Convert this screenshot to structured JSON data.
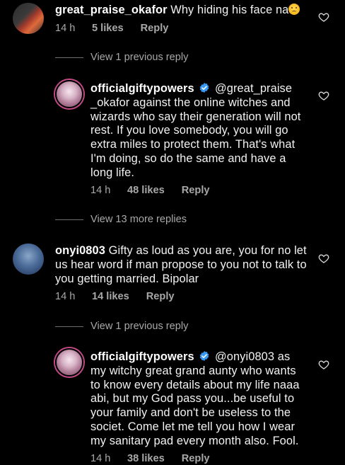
{
  "comments": [
    {
      "username": "great_praise_okafor",
      "text": "Why hiding his face na",
      "emoji": "worried-face",
      "time": "14 h",
      "likes": "5 likes",
      "reply_label": "Reply"
    },
    {
      "username": "officialgiftypowers",
      "verified": true,
      "mention": "@great_praise _okafor",
      "text": "against the online witches and wizards who say their generation will not rest. If you love somebody, you will go extra miles to protect them. That's what I'm doing, so do the same and have a long life.",
      "time": "14 h",
      "likes": "48 likes",
      "reply_label": "Reply"
    },
    {
      "username": "onyi0803",
      "text": "Gifty as loud as you are, you for no let us hear word if man propose to you not to talk to you getting married. Bipolar",
      "time": "14 h",
      "likes": "14 likes",
      "reply_label": "Reply"
    },
    {
      "username": "officialgiftypowers",
      "verified": true,
      "mention": "@onyi0803",
      "text": "as my witchy great grand aunty who wants to know every details about my life naaa abi, but my God pass you...be useful to your family and don't be useless to the societ. Come let me tell you how I wear my sanitary pad every month also. Fool.",
      "time": "14 h",
      "likes": "38 likes",
      "reply_label": "Reply"
    }
  ],
  "view_replies": [
    "View 1 previous reply",
    "View 13 more replies",
    "View 1 previous reply"
  ],
  "colors": {
    "background": "#000000",
    "text": "#f2f2f2",
    "meta": "#a8a8a8",
    "verified_badge": "#3897f0"
  }
}
